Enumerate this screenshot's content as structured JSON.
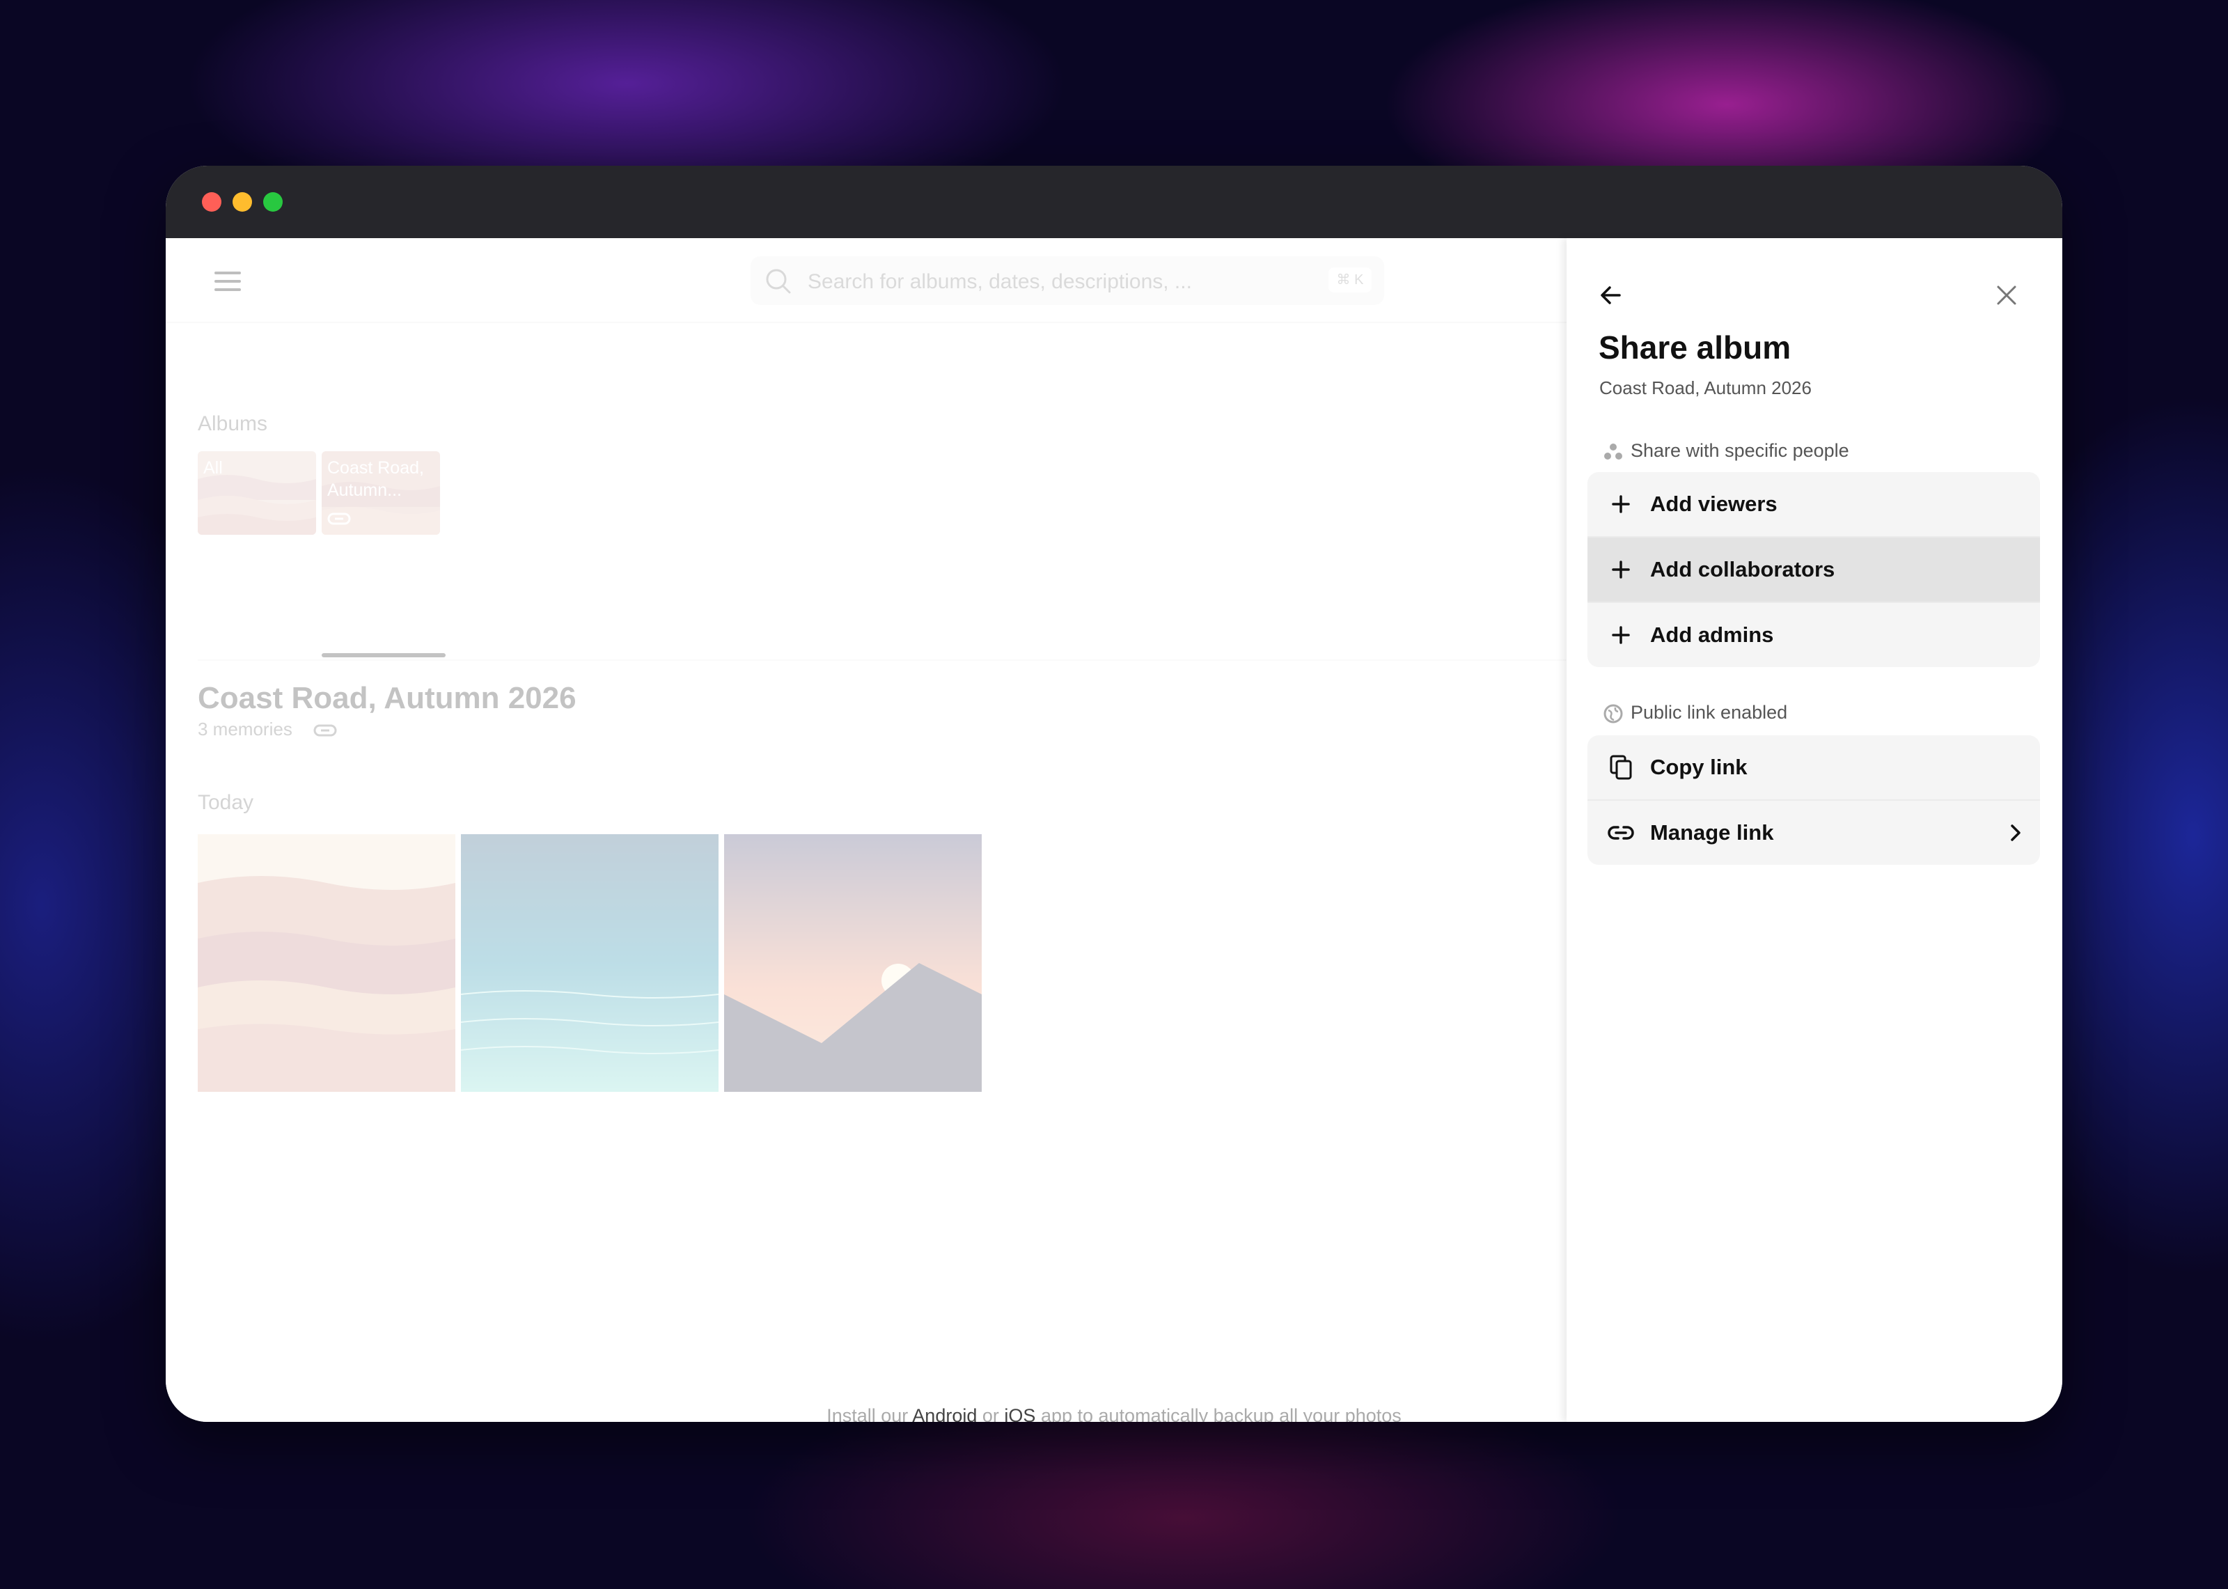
{
  "search": {
    "placeholder": "Search for albums, dates, descriptions, ...",
    "shortcut": "⌘ K"
  },
  "albums": {
    "label": "Albums",
    "items": [
      {
        "label": "All"
      },
      {
        "label": "Coast Road, Autumn..."
      }
    ]
  },
  "album": {
    "title": "Coast Road, Autumn 2026",
    "count": "3 memories",
    "section": "Today"
  },
  "footer": {
    "prefix": "Install our",
    "android": "Android",
    "or": "or",
    "ios": "iOS",
    "suffix": "app to automatically backup all your photos"
  },
  "panel": {
    "title": "Share album",
    "subtitle": "Coast Road, Autumn 2026",
    "people_label": "Share with specific people",
    "people_actions": [
      "Add viewers",
      "Add collaborators",
      "Add admins"
    ],
    "public_label": "Public link enabled",
    "link_actions": [
      "Copy link",
      "Manage link"
    ]
  },
  "colors": {
    "accent_active_row": "#e3e3e3",
    "titlebar": "#26262b",
    "traffic_red": "#ff5f57",
    "traffic_yellow": "#febc2e",
    "traffic_green": "#28c840"
  },
  "icons": {
    "back": "arrow-left-icon",
    "close": "close-icon",
    "add": "plus-icon",
    "copy": "copy-icon",
    "link": "link-icon",
    "chevron": "chevron-right-icon",
    "people": "people-icon",
    "globe": "globe-icon"
  }
}
